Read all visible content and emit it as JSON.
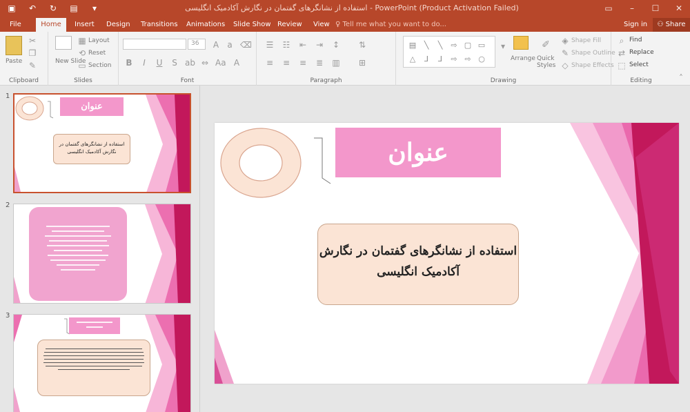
{
  "titlebar": {
    "title": "استفاده از نشانگرهای گفتمان در نگارش آکادمیک انگلیسی - PowerPoint (Product Activation Failed)",
    "qat_icons": [
      "save-icon",
      "undo-icon",
      "redo-icon",
      "start-from-beginning-icon",
      "customize-qat-icon"
    ]
  },
  "tabs": [
    {
      "label": "File",
      "name": "tab-file"
    },
    {
      "label": "Home",
      "name": "tab-home",
      "active": true
    },
    {
      "label": "Insert",
      "name": "tab-insert"
    },
    {
      "label": "Design",
      "name": "tab-design"
    },
    {
      "label": "Transitions",
      "name": "tab-transitions"
    },
    {
      "label": "Animations",
      "name": "tab-animations"
    },
    {
      "label": "Slide Show",
      "name": "tab-slide-show"
    },
    {
      "label": "Review",
      "name": "tab-review"
    },
    {
      "label": "View",
      "name": "tab-view"
    }
  ],
  "tell_me": "Tell me what you want to do...",
  "account": {
    "sign_in": "Sign in",
    "share": "Share"
  },
  "ribbon": {
    "clipboard": {
      "label": "Clipboard",
      "paste": "Paste"
    },
    "slides": {
      "label": "Slides",
      "new_slide": "New Slide",
      "layout": "Layout",
      "reset": "Reset",
      "section": "Section"
    },
    "font": {
      "label": "Font",
      "size": "36"
    },
    "paragraph": {
      "label": "Paragraph"
    },
    "drawing": {
      "label": "Drawing",
      "arrange": "Arrange",
      "quick_styles": "Quick Styles",
      "shape_fill": "Shape Fill",
      "shape_outline": "Shape Outline",
      "shape_effects": "Shape Effects"
    },
    "editing": {
      "label": "Editing",
      "find": "Find",
      "replace": "Replace",
      "select": "Select"
    }
  },
  "thumbnails": {
    "slide1": {
      "number": "1",
      "title": "عنوان",
      "body": "استفاده از نشانگرهای گفتمان در نگارش آکادمیک انگلیسی"
    },
    "slide2": {
      "number": "2"
    },
    "slide3": {
      "number": "3"
    }
  },
  "slide": {
    "title": "عنوان",
    "body_line1": "استفاده از نشانگرهای گفتمان در نگارش",
    "body_line2": "آکادمیک انگلیسی"
  },
  "colors": {
    "accent": "#b7472a",
    "title_pink": "#f397cb",
    "body_fill": "#fbe4d5",
    "magenta": "#c2185b"
  }
}
